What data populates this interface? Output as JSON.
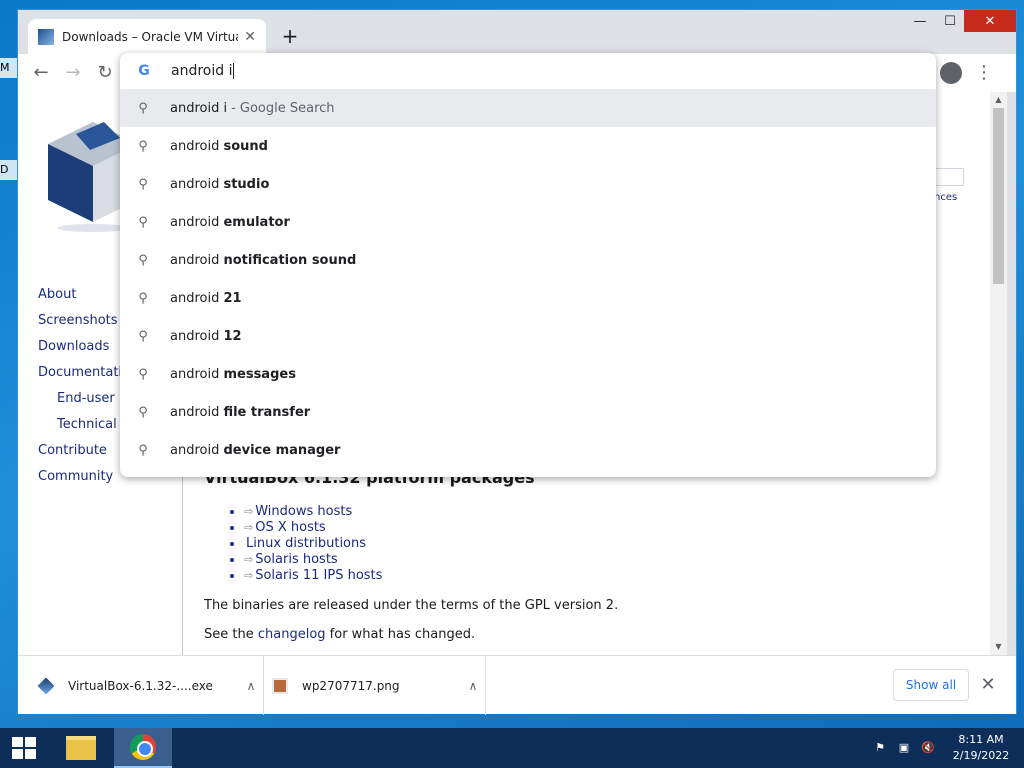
{
  "desktop": {
    "frag_top": "M",
    "frag_mid": "D"
  },
  "browser": {
    "tab_title": "Downloads – Oracle VM VirtualBox",
    "tab_close": "✕",
    "new_tab": "+",
    "window_controls": {
      "minimize": "—",
      "maximize": "☐",
      "close": "✕"
    },
    "nav": {
      "back": "←",
      "forward": "→",
      "reload": "↻",
      "menu": "⋮"
    }
  },
  "omnibox": {
    "input_value": "android i",
    "google_icon": "G",
    "suggestions": [
      {
        "prefix": "android i",
        "bold": "",
        "suffix": "- Google Search"
      },
      {
        "prefix": "android ",
        "bold": "sound",
        "suffix": ""
      },
      {
        "prefix": "android ",
        "bold": "studio",
        "suffix": ""
      },
      {
        "prefix": "android ",
        "bold": "emulator",
        "suffix": ""
      },
      {
        "prefix": "android ",
        "bold": "notification sound",
        "suffix": ""
      },
      {
        "prefix": "android ",
        "bold": "21",
        "suffix": ""
      },
      {
        "prefix": "android ",
        "bold": "12",
        "suffix": ""
      },
      {
        "prefix": "android ",
        "bold": "messages",
        "suffix": ""
      },
      {
        "prefix": "android ",
        "bold": "file transfer",
        "suffix": ""
      },
      {
        "prefix": "android ",
        "bold": "device manager",
        "suffix": ""
      }
    ],
    "search_glyph": "⚲"
  },
  "page": {
    "sidenav": [
      "About",
      "Screenshots",
      "Downloads",
      "Documentation",
      "End-user",
      "Technical",
      "Contribute",
      "Community"
    ],
    "right_link": "nces",
    "heading": "VirtualBox 6.1.32 platform packages",
    "packages": [
      {
        "ext": "⇨",
        "label": "Windows hosts"
      },
      {
        "ext": "⇨",
        "label": "OS X hosts"
      },
      {
        "ext": "",
        "label": "Linux distributions"
      },
      {
        "ext": "⇨",
        "label": "Solaris hosts"
      },
      {
        "ext": "⇨",
        "label": "Solaris 11 IPS hosts"
      }
    ],
    "para1": "The binaries are released under the terms of the GPL version 2.",
    "para2_pre": "See the ",
    "para2_link": "changelog",
    "para2_post": " for what has changed."
  },
  "scrollbar": {
    "up": "▲",
    "down": "▼"
  },
  "downloads": {
    "items": [
      {
        "name": "VirtualBox-6.1.32-....exe",
        "chevron": "∧"
      },
      {
        "name": "wp2707717.png",
        "chevron": "∧"
      }
    ],
    "show_all": "Show all",
    "close": "✕"
  },
  "taskbar": {
    "tray": [
      "⚑",
      "▣",
      "🔇"
    ],
    "time": "8:11 AM",
    "date": "2/19/2022"
  }
}
